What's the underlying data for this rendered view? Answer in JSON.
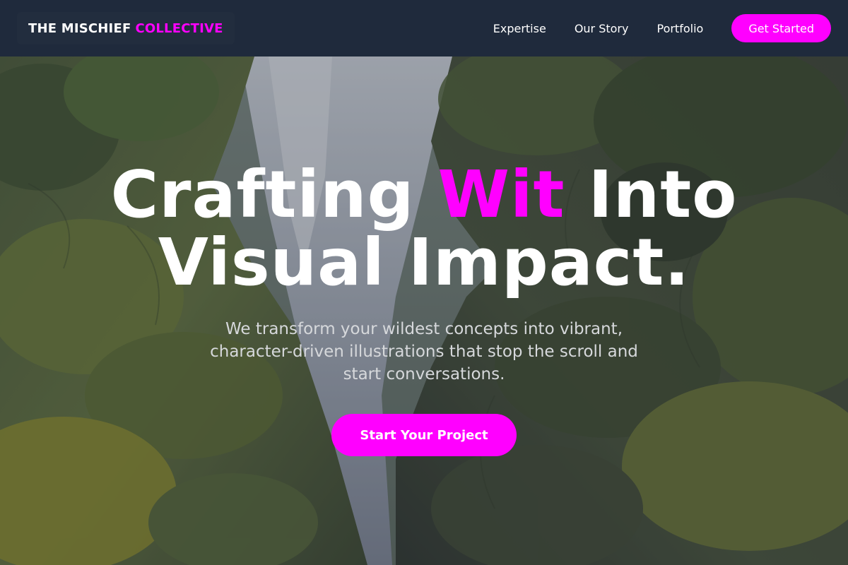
{
  "brand": {
    "name_part1": "THE MISCHIEF",
    "name_part2": "COLLECTIVE"
  },
  "nav": {
    "links": [
      "Expertise",
      "Our Story",
      "Portfolio"
    ],
    "cta_label": "Get Started"
  },
  "hero": {
    "headline_before": "Crafting",
    "headline_accent": "Wit",
    "headline_after": "Into",
    "headline_line2": "Visual Impact.",
    "subheadline": "We transform your wildest concepts into vibrant, character-driven illustrations that stop the scroll and start conversations.",
    "cta_label": "Start Your Project",
    "background": "painted-waterfall-landscape"
  },
  "colors": {
    "accent": "#ff00ff",
    "navbar": "#1f2a3c",
    "text": "#ffffff"
  }
}
